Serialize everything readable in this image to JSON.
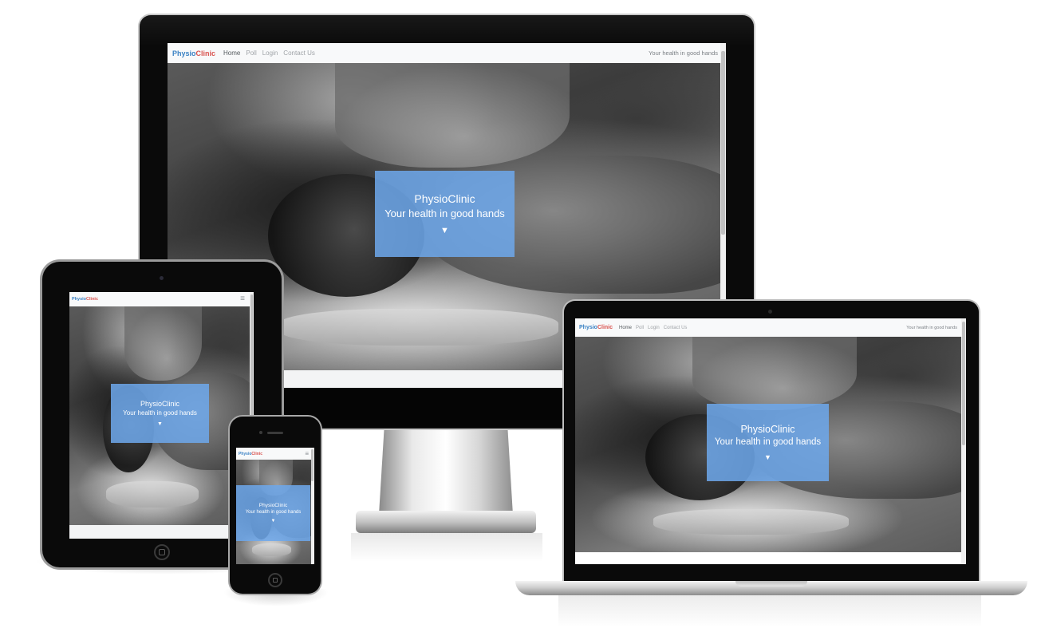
{
  "site": {
    "brand_physio": "Physio",
    "brand_clinic": "Clinic",
    "nav": [
      "Home",
      "Poll",
      "Login",
      "Contact Us"
    ],
    "tagline": "Your health in good hands",
    "hero_title": "PhysioClinic",
    "hero_subtitle": "Your health in good hands",
    "hero_arrow": "▼",
    "menu_icon": "≡"
  },
  "colors": {
    "brand_blue": "#3b82c4",
    "brand_red": "#d9534f",
    "hero_box": "#6ea8eb",
    "navbar_bg": "#f8f9fa"
  },
  "devices": [
    "desktop-monitor",
    "laptop",
    "tablet",
    "phone"
  ]
}
